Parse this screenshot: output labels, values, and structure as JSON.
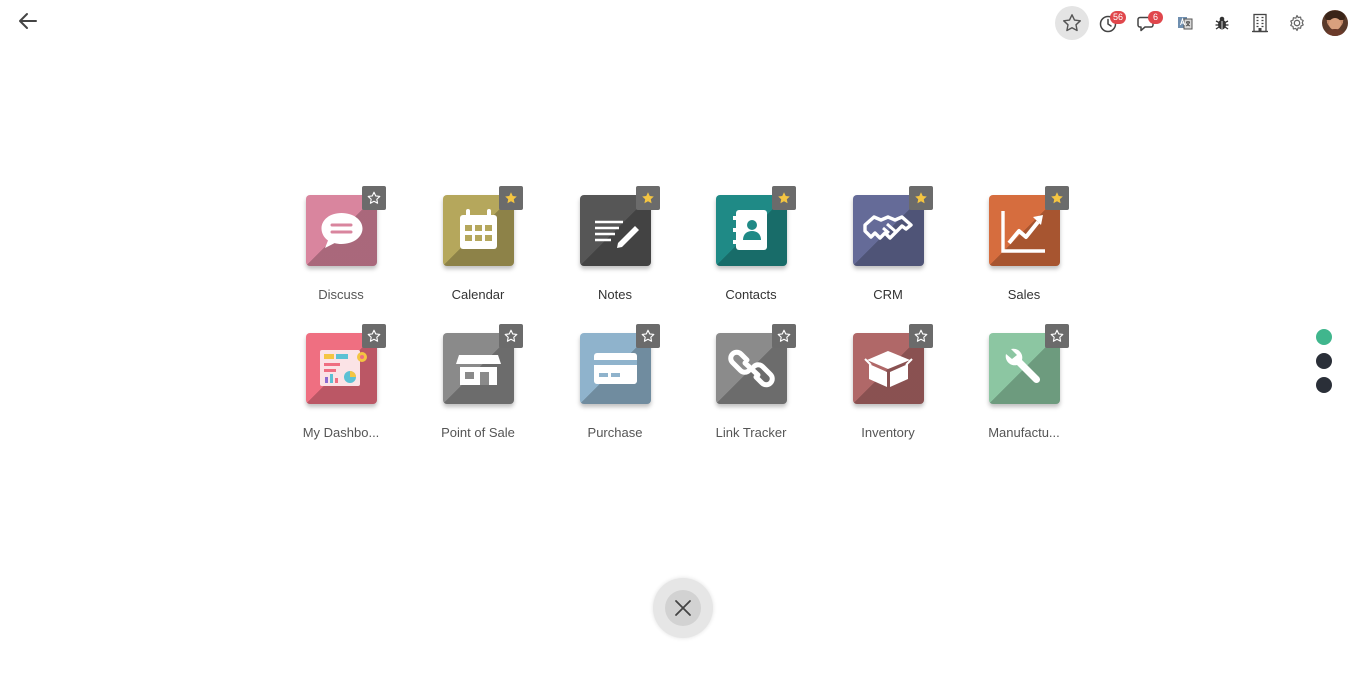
{
  "header": {
    "back_icon": "arrow-left-icon",
    "activity_badge": "56",
    "messages_badge": "6"
  },
  "apps": [
    {
      "label": "Discuss",
      "icon": "chat-bubble-icon",
      "color": "#d9859e",
      "favorite": false
    },
    {
      "label": "Calendar",
      "icon": "calendar-icon",
      "color": "#b5a75c",
      "favorite": true
    },
    {
      "label": "Notes",
      "icon": "notes-pen-icon",
      "color": "#565656",
      "favorite": true
    },
    {
      "label": "Contacts",
      "icon": "address-book-icon",
      "color": "#1f8a86",
      "favorite": true
    },
    {
      "label": "CRM",
      "icon": "handshake-icon",
      "color": "#656b98",
      "favorite": true
    },
    {
      "label": "Sales",
      "icon": "trend-chart-icon",
      "color": "#d66d3e",
      "favorite": true
    },
    {
      "label": "My Dashbo...",
      "icon": "dashboard-icon",
      "color": "#ef6f81",
      "favorite": false
    },
    {
      "label": "Point of Sale",
      "icon": "shop-icon",
      "color": "#8a8a8a",
      "favorite": false
    },
    {
      "label": "Purchase",
      "icon": "credit-card-icon",
      "color": "#8fb3cc",
      "favorite": false
    },
    {
      "label": "Link Tracker",
      "icon": "link-icon",
      "color": "#8b8b8b",
      "favorite": false
    },
    {
      "label": "Inventory",
      "icon": "box-icon",
      "color": "#b06868",
      "favorite": false
    },
    {
      "label": "Manufactu...",
      "icon": "wrench-icon",
      "color": "#8cc6a2",
      "favorite": false
    }
  ],
  "pager": {
    "pages": 3,
    "active_index": 0,
    "active_color": "#40b68d"
  },
  "colors": {
    "favorite_star": "#f4c542",
    "badge": "#e0474c"
  }
}
